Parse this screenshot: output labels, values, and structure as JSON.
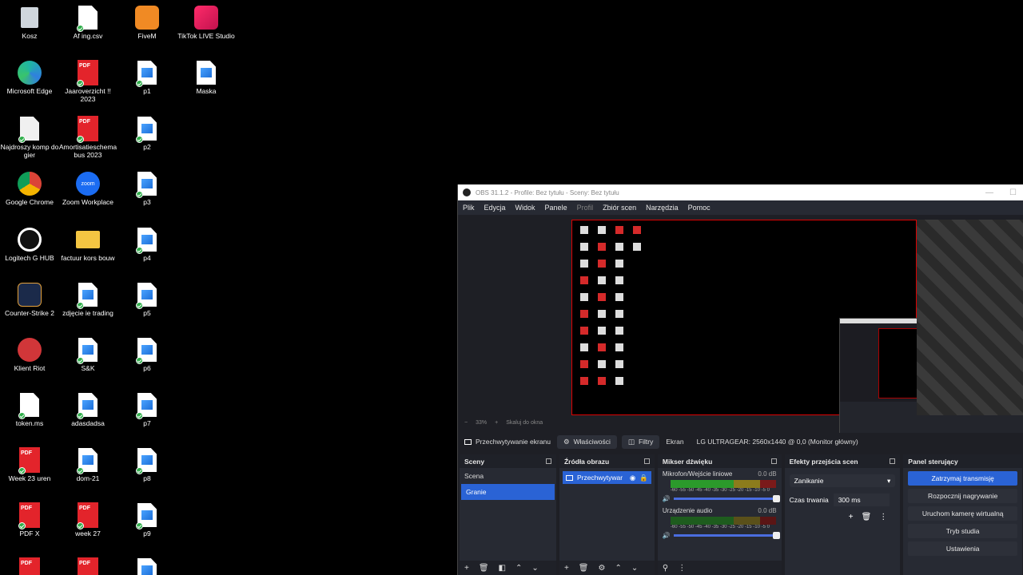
{
  "desktop": {
    "icons": [
      {
        "label": "Kosz",
        "icon": "recycle-bin-icon"
      },
      {
        "label": "Af ing.csv",
        "icon": "csv-file-icon"
      },
      {
        "label": "FiveM",
        "icon": "fivem-icon"
      },
      {
        "label": "TikTok LIVE Studio",
        "icon": "tiktok-icon"
      },
      {
        "label": "Microsoft Edge",
        "icon": "edge-icon"
      },
      {
        "label": "Jaaroverzicht !! 2023",
        "icon": "pdf-icon"
      },
      {
        "label": "p1",
        "icon": "image-file-icon"
      },
      {
        "label": "Maska",
        "icon": "image-file-icon"
      },
      {
        "label": "Najdroszy komp do gier",
        "icon": "text-file-icon"
      },
      {
        "label": "Amortisatieschema bus 2023",
        "icon": "pdf-icon"
      },
      {
        "label": "p2",
        "icon": "image-file-icon"
      },
      {
        "label": "Google Chrome",
        "icon": "chrome-icon"
      },
      {
        "label": "Zoom Workplace",
        "icon": "zoom-icon"
      },
      {
        "label": "p3",
        "icon": "image-file-icon"
      },
      {
        "label": "Logitech G HUB",
        "icon": "logitech-icon"
      },
      {
        "label": "factuur kors bouw",
        "icon": "folder-icon"
      },
      {
        "label": "p4",
        "icon": "image-file-icon"
      },
      {
        "label": "Counter-Strike 2",
        "icon": "cs2-icon"
      },
      {
        "label": "zdjęcie ie trading",
        "icon": "image-file-icon"
      },
      {
        "label": "p5",
        "icon": "image-file-icon"
      },
      {
        "label": "Klient Riot",
        "icon": "riot-icon"
      },
      {
        "label": "S&K",
        "icon": "image-file-icon"
      },
      {
        "label": "p6",
        "icon": "image-file-icon"
      },
      {
        "label": "token.ms",
        "icon": "text-file-icon"
      },
      {
        "label": "adasdadsa",
        "icon": "image-file-icon"
      },
      {
        "label": "p7",
        "icon": "image-file-icon"
      },
      {
        "label": "Week 23 uren",
        "icon": "pdf-icon"
      },
      {
        "label": "dom-21",
        "icon": "image-file-icon"
      },
      {
        "label": "p8",
        "icon": "image-file-icon"
      },
      {
        "label": "PDF X",
        "icon": "pdf-icon"
      },
      {
        "label": "week 27",
        "icon": "pdf-icon"
      },
      {
        "label": "p9",
        "icon": "image-file-icon"
      }
    ]
  },
  "obs": {
    "title": "OBS 31.1.2 - Profile: Bez tytułu - Sceny: Bez tytułu",
    "menu": [
      "Plik",
      "Edycja",
      "Widok",
      "Panele",
      "Profil",
      "Zbiór scen",
      "Narzędzia",
      "Pomoc"
    ],
    "zoom": {
      "minus": "−",
      "value": "33%",
      "plus": "+",
      "fit": "Skaluj do okna"
    },
    "source_bar": {
      "source_name": "Przechwytywanie ekranu",
      "properties": "Właściwości",
      "filters": "Filtry",
      "screen_label": "Ekran",
      "screen_value": "LG ULTRAGEAR: 2560x1440 @ 0,0 (Monitor główny)"
    },
    "scenes": {
      "title": "Sceny",
      "items": [
        {
          "label": "Scena"
        },
        {
          "label": "Granie"
        }
      ]
    },
    "sources": {
      "title": "Źródła obrazu",
      "items": [
        {
          "label": "Przechwytywar"
        }
      ]
    },
    "mixer": {
      "title": "Mikser dźwięku",
      "channels": [
        {
          "name": "Mikrofon/Wejście liniowe",
          "db": "0.0 dB"
        },
        {
          "name": "Urządzenie audio",
          "db": "0.0 dB"
        }
      ],
      "scale": "-60 -55 -50 -45 -40 -35 -30 -25 -20 -15 -10 -5 0"
    },
    "transitions": {
      "title": "Efekty przejścia scen",
      "selected": "Zanikanie",
      "duration_label": "Czas trwania",
      "duration_value": "300 ms"
    },
    "controls": {
      "title": "Panel sterujący",
      "buttons": [
        {
          "label": "Zatrzymaj transmisję"
        },
        {
          "label": "Rozpocznij nagrywanie"
        },
        {
          "label": "Uruchom kamerę wirtualną"
        },
        {
          "label": "Tryb studia"
        },
        {
          "label": "Ustawienia"
        }
      ]
    }
  }
}
